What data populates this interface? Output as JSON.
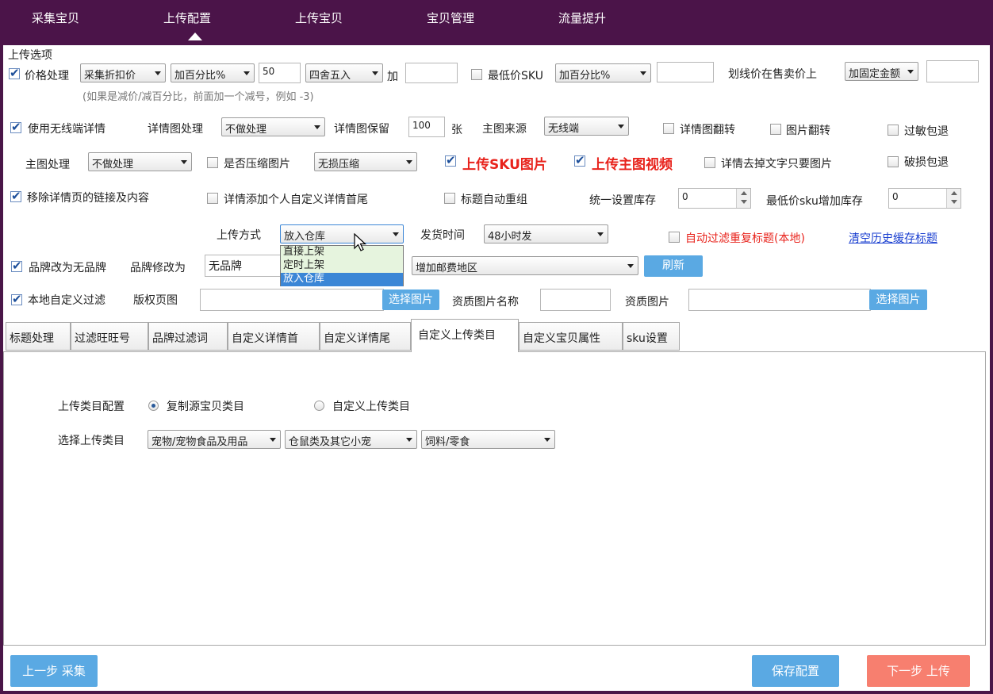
{
  "nav": {
    "items": [
      "采集宝贝",
      "上传配置",
      "上传宝贝",
      "宝贝管理",
      "流量提升"
    ]
  },
  "section_title": "上传选项",
  "row1": {
    "price_label": "价格处理",
    "price_source": "采集折扣价",
    "price_mode": "加百分比%",
    "price_value": "50",
    "rounding": "四舍五入",
    "add_label": "加",
    "add_value": "",
    "min_sku_label": "最低价SKU",
    "min_sku_mode": "加百分比%",
    "min_sku_value": "",
    "strike_label": "划线价在售卖价上",
    "strike_mode": "加固定金额",
    "strike_value": "",
    "hint": "(如果是减价/减百分比，前面加一个减号，例如 -3)"
  },
  "row2": {
    "mobile_detail": "使用无线端详情",
    "detail_img_label": "详情图处理",
    "detail_img_mode": "不做处理",
    "detail_keep_label": "详情图保留",
    "detail_keep_value": "100",
    "detail_keep_unit": "张",
    "main_src_label": "主图来源",
    "main_src_value": "无线端",
    "detail_flip": "详情图翻转",
    "img_flip": "图片翻转",
    "allergy_refund": "过敏包退"
  },
  "row3": {
    "main_img_label": "主图处理",
    "main_img_mode": "不做处理",
    "compress_label": "是否压缩图片",
    "compress_mode": "无损压缩",
    "upload_sku_img": "上传SKU图片",
    "upload_main_video": "上传主图视频",
    "detail_remove_text": "详情去掉文字只要图片",
    "damage_refund": "破损包退"
  },
  "row4": {
    "remove_links": "移除详情页的链接及内容",
    "add_custom_detail": "详情添加个人自定义详情首尾",
    "title_regroup": "标题自动重组",
    "stock_label": "统一设置库存",
    "stock_value": "0",
    "min_sku_stock_label": "最低价sku增加库存",
    "min_sku_stock_value": "0"
  },
  "row5": {
    "upload_mode_label": "上传方式",
    "upload_mode_value": "放入仓库",
    "ship_time_label": "发货时间",
    "ship_time_value": "48小时发",
    "auto_filter_title": "自动过滤重复标题(本地)",
    "clear_cache_link": "清空历史缓存标题",
    "dropdown_options": [
      "直接上架",
      "定时上架",
      "放入仓库"
    ]
  },
  "row6": {
    "brand_to_none": "品牌改为无品牌",
    "brand_change_label": "品牌修改为",
    "brand_value": "无品牌",
    "postage_region": "增加邮费地区",
    "refresh_btn": "刷新"
  },
  "row7": {
    "local_filter": "本地自定义过滤",
    "copyright_label": "版权页图",
    "copyright_value": "",
    "select_img_btn": "选择图片",
    "qual_name_label": "资质图片名称",
    "qual_name_value": "",
    "qual_img_label": "资质图片",
    "qual_img_value": "",
    "select_img_btn2": "选择图片"
  },
  "tabs": [
    "标题处理",
    "过滤旺旺号",
    "品牌过滤词",
    "自定义详情首",
    "自定义详情尾",
    "自定义上传类目",
    "自定义宝贝属性",
    "sku设置"
  ],
  "tab_content": {
    "config_label": "上传类目配置",
    "radio_copy": "复制源宝贝类目",
    "radio_custom": "自定义上传类目",
    "select_label": "选择上传类目",
    "cat1": "宠物/宠物食品及用品",
    "cat2": "仓鼠类及其它小宠",
    "cat3": "饲料/零食"
  },
  "footer": {
    "prev": "上一步 采集",
    "save": "保存配置",
    "next": "下一步 上传"
  },
  "colors": {
    "nav_bg": "#4b1449",
    "blue_button": "#5aa9e3",
    "red_button": "#f77f6f",
    "red_text": "#e8231c"
  }
}
